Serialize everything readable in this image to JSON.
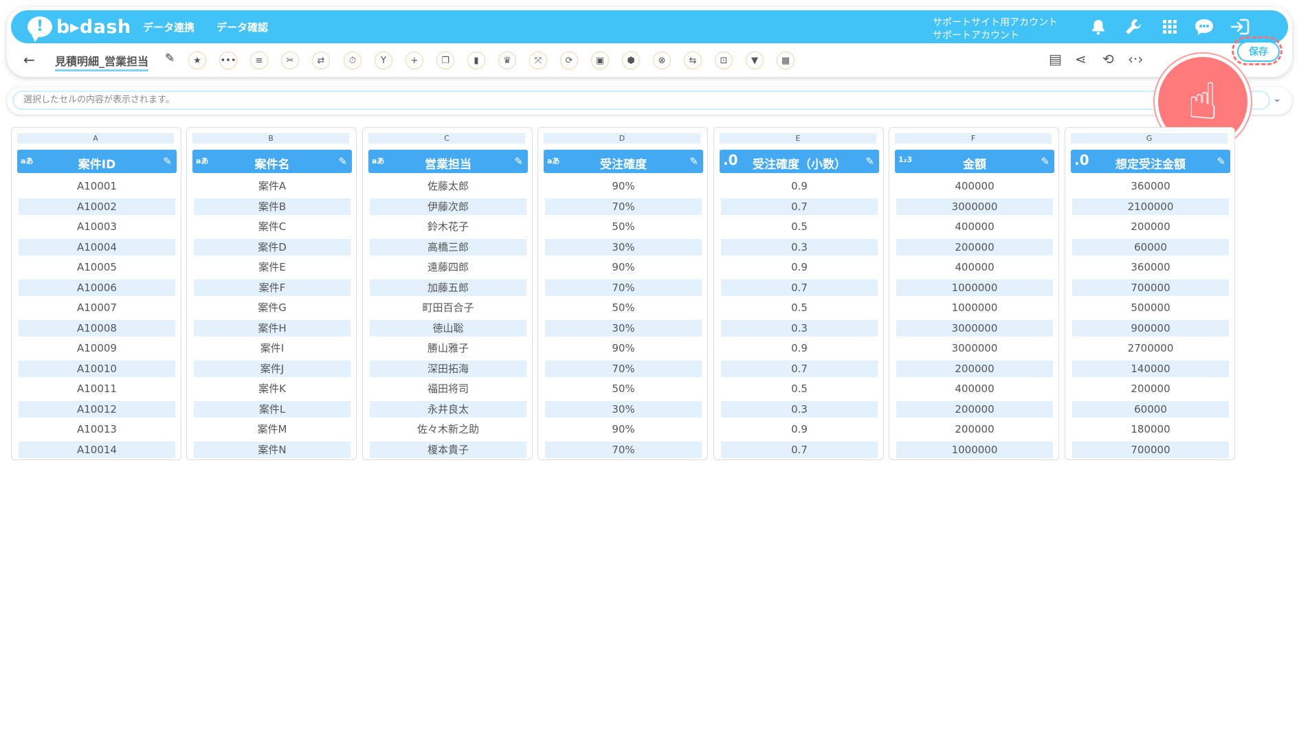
{
  "header": {
    "logo_mark": "!",
    "logo_text": "b▸dash",
    "nav": [
      "データ連携",
      "データ確認"
    ],
    "account_line1": "サポートサイト用アカウント",
    "account_line2": "サポートアカウント",
    "icons": [
      "bell-icon",
      "wrench-icon",
      "grid-icon",
      "chat-icon",
      "logout-icon"
    ]
  },
  "toolbar": {
    "back_glyph": "←",
    "title": "見積明細_営業担当",
    "save_label": "保存"
  },
  "formula": {
    "placeholder": "選択したセルの内容が表示されます。",
    "chevron": "⌄"
  },
  "columns": [
    {
      "letter": "A",
      "type": "aあ",
      "header": "案件ID",
      "cells": [
        "A10001",
        "A10002",
        "A10003",
        "A10004",
        "A10005",
        "A10006",
        "A10007",
        "A10008",
        "A10009",
        "A10010",
        "A10011",
        "A10012",
        "A10013",
        "A10014"
      ]
    },
    {
      "letter": "B",
      "type": "aあ",
      "header": "案件名",
      "cells": [
        "案件A",
        "案件B",
        "案件C",
        "案件D",
        "案件E",
        "案件F",
        "案件G",
        "案件H",
        "案件I",
        "案件J",
        "案件K",
        "案件L",
        "案件M",
        "案件N"
      ]
    },
    {
      "letter": "C",
      "type": "aあ",
      "header": "営業担当",
      "cells": [
        "佐藤太郎",
        "伊藤次郎",
        "鈴木花子",
        "高橋三郎",
        "遠藤四郎",
        "加藤五郎",
        "町田百合子",
        "徳山聡",
        "勝山雅子",
        "深田拓海",
        "福田将司",
        "永井良太",
        "佐々木新之助",
        "榎本貴子"
      ]
    },
    {
      "letter": "D",
      "type": "aあ",
      "header": "受注確度",
      "cells": [
        "90%",
        "70%",
        "50%",
        "30%",
        "90%",
        "70%",
        "50%",
        "30%",
        "90%",
        "70%",
        "50%",
        "30%",
        "90%",
        "70%"
      ]
    },
    {
      "letter": "E",
      "type": ".0",
      "header": "受注確度（小数）",
      "cells": [
        "0.9",
        "0.7",
        "0.5",
        "0.3",
        "0.9",
        "0.7",
        "0.5",
        "0.3",
        "0.9",
        "0.7",
        "0.5",
        "0.3",
        "0.9",
        "0.7"
      ]
    },
    {
      "letter": "F",
      "type": "1₂3",
      "header": "金額",
      "cells": [
        "400000",
        "3000000",
        "400000",
        "200000",
        "400000",
        "1000000",
        "1000000",
        "3000000",
        "3000000",
        "200000",
        "400000",
        "200000",
        "200000",
        "1000000"
      ]
    },
    {
      "letter": "G",
      "type": ".0",
      "header": "想定受注金額",
      "cells": [
        "360000",
        "2100000",
        "200000",
        "60000",
        "360000",
        "700000",
        "500000",
        "900000",
        "2700000",
        "140000",
        "200000",
        "60000",
        "180000",
        "700000"
      ]
    }
  ]
}
